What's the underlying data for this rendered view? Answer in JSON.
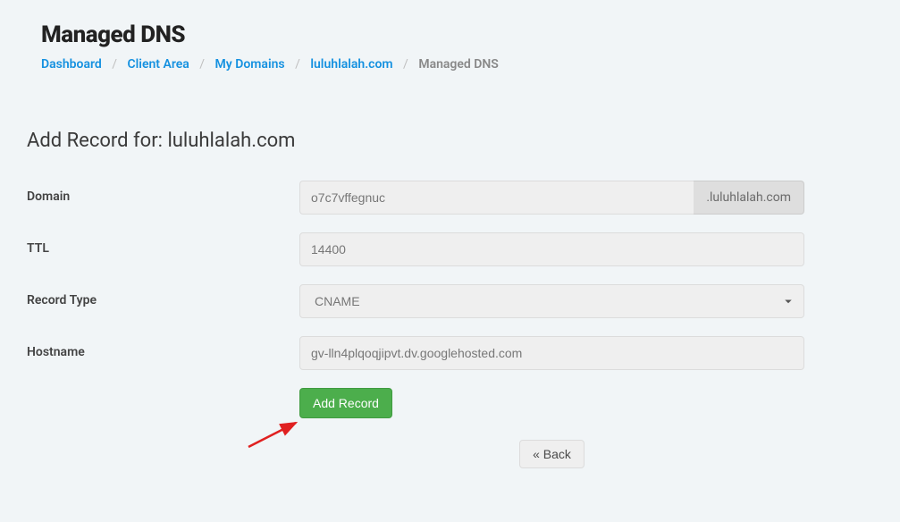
{
  "header": {
    "title": "Managed DNS"
  },
  "breadcrumb": {
    "items": [
      {
        "label": "Dashboard"
      },
      {
        "label": "Client Area"
      },
      {
        "label": "My Domains"
      },
      {
        "label": "luluhlalah.com"
      }
    ],
    "current": "Managed DNS"
  },
  "section_heading": "Add Record for: luluhlalah.com",
  "form": {
    "domain": {
      "label": "Domain",
      "value": "o7c7vffegnuc",
      "suffix": ".luluhlalah.com"
    },
    "ttl": {
      "label": "TTL",
      "value": "14400"
    },
    "record_type": {
      "label": "Record Type",
      "value": "CNAME"
    },
    "hostname": {
      "label": "Hostname",
      "value": "gv-lln4plqoqjipvt.dv.googlehosted.com"
    },
    "submit_label": "Add Record",
    "back_label": "« Back"
  }
}
